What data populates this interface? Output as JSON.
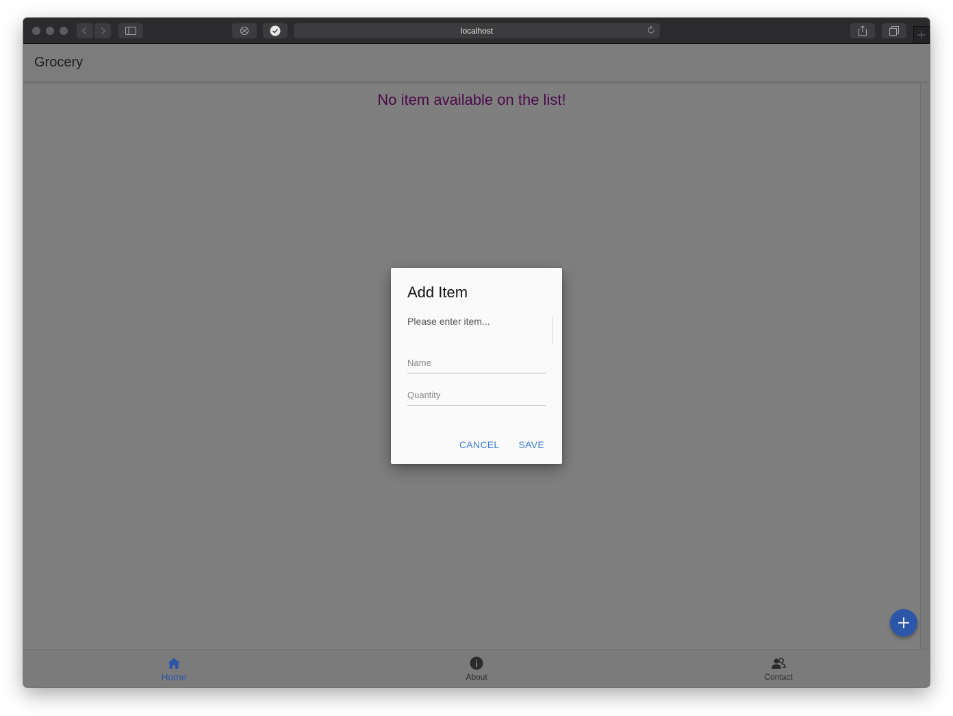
{
  "browser": {
    "url": "localhost",
    "icons": {
      "back": "chevron-left-icon",
      "forward": "chevron-right-icon",
      "sidebar": "sidebar-icon",
      "shield": "shield-icon",
      "check": "check-circle-icon",
      "reload": "reload-icon",
      "share": "share-icon",
      "tabs": "tabs-icon",
      "new_tab": "plus-icon"
    }
  },
  "app": {
    "title": "Grocery",
    "empty_message": "No item available on the list!",
    "accent_color": "#2c56a8",
    "message_color": "#4a0b48"
  },
  "dialog": {
    "title": "Add Item",
    "message": "Please enter item...",
    "fields": {
      "name": {
        "placeholder": "Name",
        "value": ""
      },
      "quantity": {
        "placeholder": "Quantity",
        "value": ""
      }
    },
    "cancel_label": "CANCEL",
    "save_label": "SAVE",
    "button_color": "#3b7fd6"
  },
  "bottom_nav": {
    "items": [
      {
        "label": "Home",
        "icon": "home-icon",
        "active": true
      },
      {
        "label": "About",
        "icon": "info-icon",
        "active": false
      },
      {
        "label": "Contact",
        "icon": "contact-icon",
        "active": false
      }
    ]
  },
  "fab": {
    "icon": "plus-icon"
  }
}
